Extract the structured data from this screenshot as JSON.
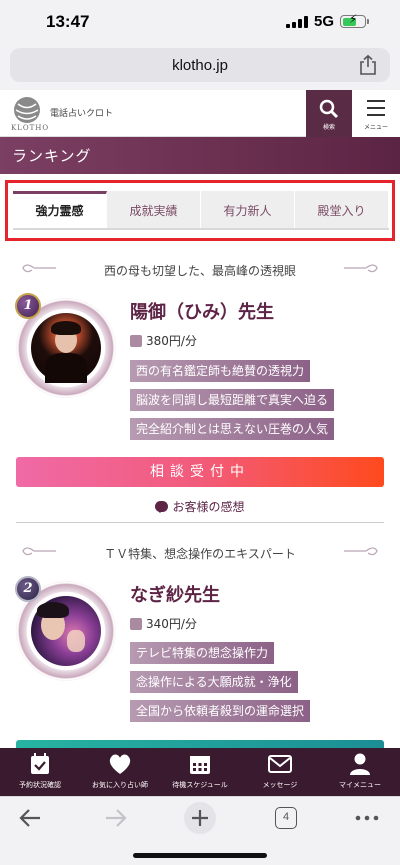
{
  "status_bar": {
    "time": "13:47",
    "network": "5G"
  },
  "browser": {
    "url": "klotho.jp",
    "tab_count": "4"
  },
  "header": {
    "logo_text": "KLOTHO",
    "site_name": "電話占いクロト",
    "search_label": "検索",
    "menu_label": "メニュー"
  },
  "section": {
    "title": "ランキング"
  },
  "tabs": [
    {
      "label": "強力霊感",
      "active": true
    },
    {
      "label": "成就実績",
      "active": false
    },
    {
      "label": "有力新人",
      "active": false
    },
    {
      "label": "殿堂入り",
      "active": false
    }
  ],
  "advisors": [
    {
      "rank": "1",
      "catchphrase": "西の母も切望した、最高峰の透視眼",
      "name": "陽御（ひみ）先生",
      "price": "380円/分",
      "tags": [
        "西の有名鑑定師も絶賛の透視力",
        "脳波を同調し最短距離で真実へ迫る",
        "完全紹介制とは思えない圧巻の人気"
      ],
      "status_label": "相談受付中",
      "reviews_label": "お客様の感想"
    },
    {
      "rank": "2",
      "catchphrase": "ＴＶ特集、想念操作のエキスパート",
      "name": "なぎ紗先生",
      "price": "340円/分",
      "tags": [
        "テレビ特集の想念操作力",
        "念操作による大願成就・浄化",
        "全国から依頼者殺到の運命選択"
      ]
    }
  ],
  "app_nav": [
    {
      "label": "予約状況確認",
      "icon": "calendar-check-icon"
    },
    {
      "label": "お気に入り占い師",
      "icon": "heart-icon"
    },
    {
      "label": "待機スケジュール",
      "icon": "calendar-icon"
    },
    {
      "label": "メッセージ",
      "icon": "envelope-icon"
    },
    {
      "label": "マイメニュー",
      "icon": "person-icon"
    }
  ],
  "colors": {
    "brand": "#5d2446",
    "accent_red": "#e5242c",
    "consult_start": "#f06aa6",
    "consult_end": "#ff4a1e"
  }
}
